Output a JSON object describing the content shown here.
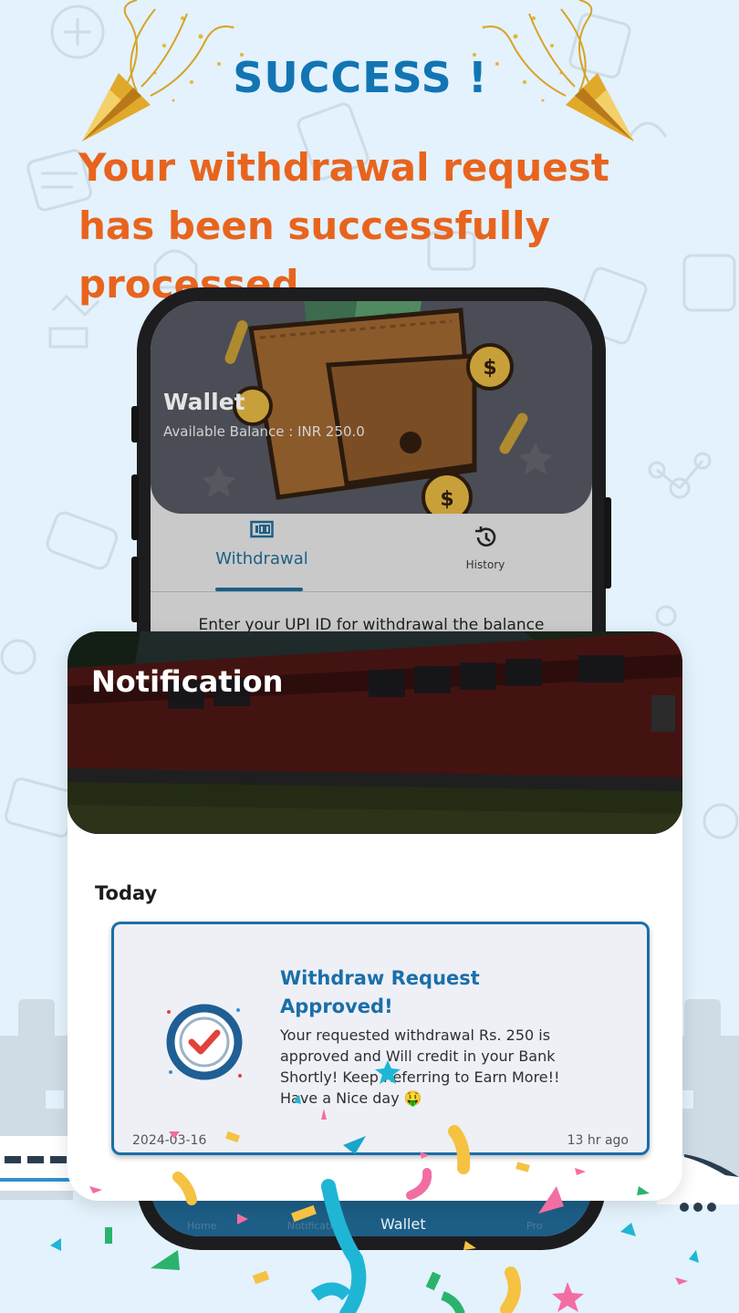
{
  "header": {
    "success_title": "SUCCESS !",
    "headline": "Your withdrawal request has been successfully processed"
  },
  "wallet_screen": {
    "title": "Wallet",
    "balance": "Available Balance : INR 250.0",
    "tabs": [
      {
        "label": "Withdrawal",
        "icon": "cash-icon",
        "selected": true
      },
      {
        "label": "History",
        "icon": "history-icon",
        "selected": false
      }
    ],
    "upi_prompt": "Enter your UPI ID for withdrawal the balance",
    "bottom_nav": [
      {
        "label": "Home",
        "icon": "home-icon"
      },
      {
        "label": "Notification",
        "icon": "bell-icon"
      },
      {
        "label": "Wallet",
        "icon": "wallet-icon",
        "selected": true
      },
      {
        "label": "Pro",
        "icon": "profile-icon"
      }
    ]
  },
  "notification_screen": {
    "title": "Notification",
    "section_label": "Today",
    "items": [
      {
        "title": "Withdraw Request Approved!",
        "body": "Your requested withdrawal Rs. 250 is approved and Will credit in your Bank Shortly! Keep Referring to Earn More!! Have a Nice day 🤑",
        "date": "2024-03-16",
        "time_ago": "13 hr ago",
        "icon": "check-badge-icon"
      }
    ]
  },
  "colors": {
    "background": "#e3f2fc",
    "success_blue": "#1275b3",
    "headline_orange": "#e8641e",
    "accent_blue": "#1a6fa8",
    "nav_blue": "#1d5e86"
  }
}
